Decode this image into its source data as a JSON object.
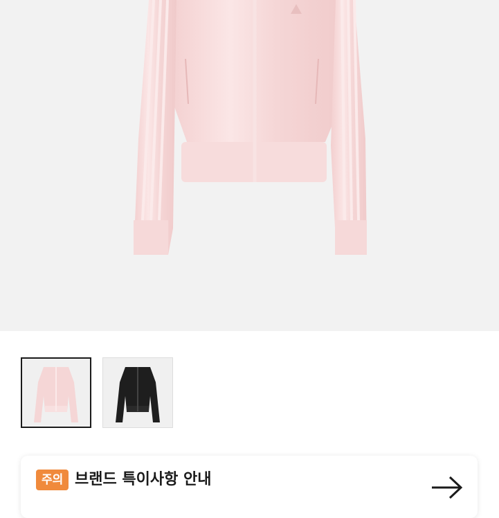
{
  "hero": {
    "image": "pink-satin-track-jacket",
    "colors": {
      "background": "#f2f2f2",
      "jacket": "#f7d8d8"
    }
  },
  "thumbnails": [
    {
      "name": "pink-jacket",
      "color": "#f5d6d6",
      "selected": true
    },
    {
      "name": "black-jacket",
      "color": "#1e1e1e",
      "selected": false
    }
  ],
  "notice": {
    "badge": "주의",
    "title": "브랜드 특이사항 안내",
    "subtitle": "",
    "icon": "arrow-right-icon",
    "colors": {
      "badge": "#f08a3c"
    }
  }
}
